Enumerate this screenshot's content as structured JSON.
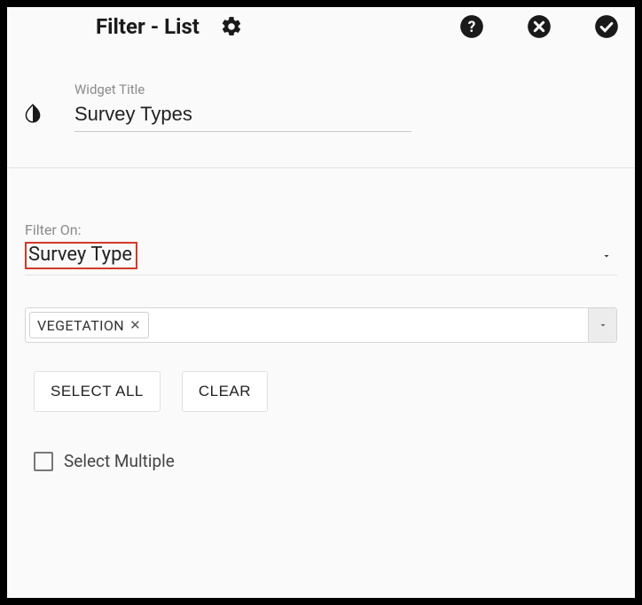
{
  "header": {
    "title": "Filter - List"
  },
  "widget_title_field": {
    "label": "Widget Title",
    "value": "Survey Types"
  },
  "filter_on": {
    "label": "Filter On:",
    "selected": "Survey Type"
  },
  "tag_select": {
    "chips": [
      {
        "label": "VEGETATION"
      }
    ]
  },
  "buttons": {
    "select_all": "SELECT ALL",
    "clear": "CLEAR"
  },
  "select_multiple": {
    "label": "Select Multiple",
    "checked": false
  }
}
